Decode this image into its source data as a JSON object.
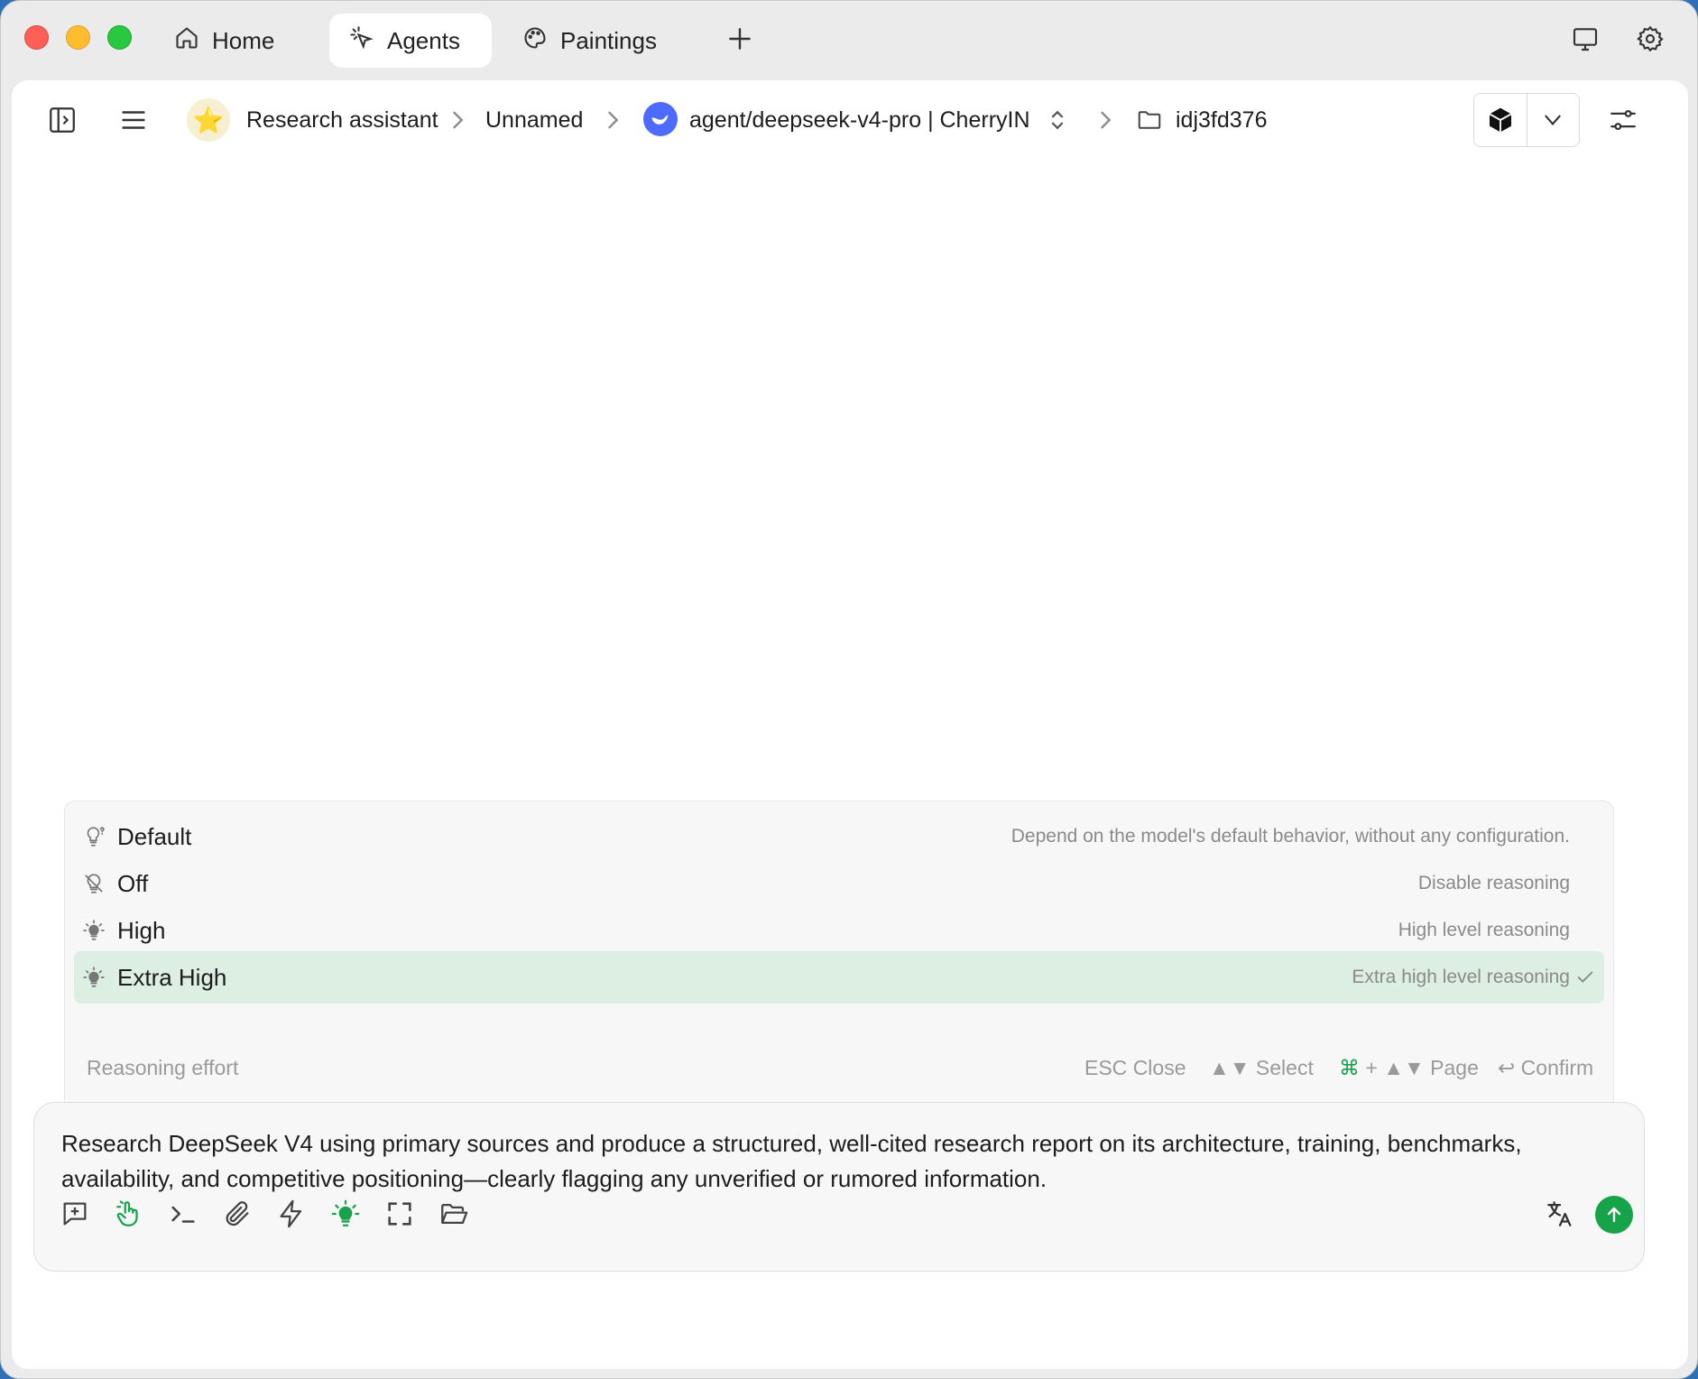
{
  "tabs": [
    {
      "label": "Home",
      "icon": "home-icon"
    },
    {
      "label": "Agents",
      "icon": "agents-icon",
      "active": true
    },
    {
      "label": "Paintings",
      "icon": "palette-icon"
    }
  ],
  "breadcrumb": {
    "agent_name": "Research assistant",
    "session_name": "Unnamed",
    "model": "agent/deepseek-v4-pro | CherryIN",
    "folder": "idj3fd376"
  },
  "reasoning_menu": {
    "options": [
      {
        "label": "Default",
        "description": "Depend on the model's default behavior, without any configuration.",
        "icon": "lightbulb-question-icon"
      },
      {
        "label": "Off",
        "description": "Disable reasoning",
        "icon": "lightbulb-off-icon"
      },
      {
        "label": "High",
        "description": "High level reasoning",
        "icon": "lightbulb-icon"
      },
      {
        "label": "Extra High",
        "description": "Extra high level reasoning",
        "icon": "lightbulb-icon",
        "selected": true
      }
    ],
    "footer": {
      "title": "Reasoning effort",
      "esc_key": "ESC",
      "esc_label": "Close",
      "select_key": "▲▼",
      "select_label": "Select",
      "page_key": "⌘",
      "page_plus": "+ ▲▼",
      "page_label": "Page",
      "confirm_key": "↩",
      "confirm_label": "Confirm"
    }
  },
  "input": {
    "text": "Research DeepSeek V4 using primary sources and produce a structured, well-cited research report on its architecture, training, benchmarks, availability, and competitive positioning—clearly flagging any unverified or rumored information."
  },
  "colors": {
    "accent": "#16a34a",
    "selected_row": "#dcefe2",
    "close": "#fe5f57",
    "minimize": "#febc2e",
    "maximize": "#28c840"
  }
}
